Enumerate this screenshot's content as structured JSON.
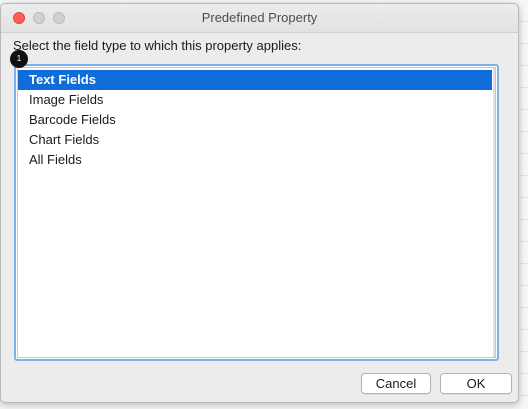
{
  "window": {
    "title": "Predefined Property"
  },
  "prompt": "Select the field type to which this property applies:",
  "callout_number": "1",
  "field_types": [
    {
      "label": "Text Fields",
      "selected": true
    },
    {
      "label": "Image Fields",
      "selected": false
    },
    {
      "label": "Barcode Fields",
      "selected": false
    },
    {
      "label": "Chart Fields",
      "selected": false
    },
    {
      "label": "All Fields",
      "selected": false
    }
  ],
  "buttons": {
    "cancel_label": "Cancel",
    "ok_label": "OK"
  },
  "colors": {
    "selection": "#0f6cd9",
    "focus_ring": "#7fb0ea",
    "close_button": "#fc5f57"
  }
}
